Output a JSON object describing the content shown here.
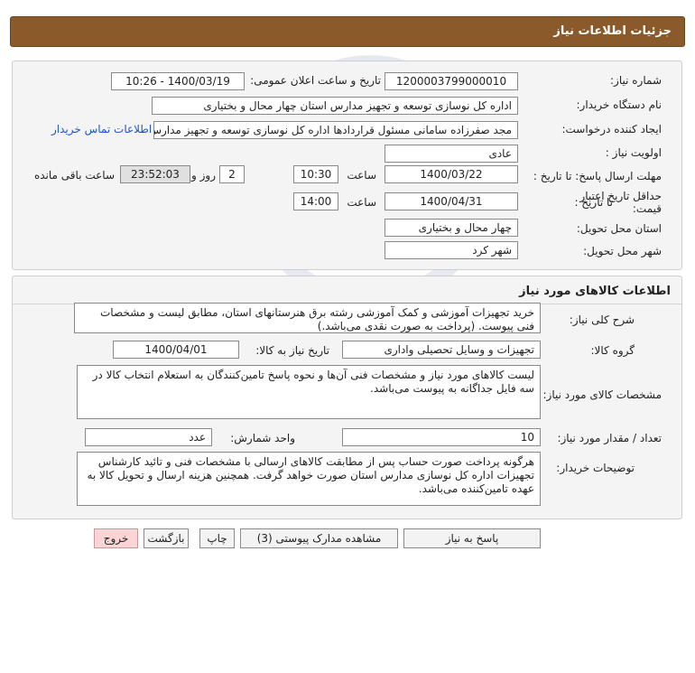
{
  "header": {
    "title": "جزئیات اطلاعات نیاز"
  },
  "fields": {
    "need_number_label": "شماره نیاز:",
    "need_number": "1200003799000010",
    "announce_label": "تاریخ و ساعت اعلان عمومی:",
    "announce_value": "1400/03/19 - 10:26",
    "buyer_label": "نام دستگاه خریدار:",
    "buyer_value": "اداره کل نوسازی  توسعه و تجهیز مدارس استان چهار محال و بختیاری",
    "creator_label": "ایجاد کننده درخواست:",
    "creator_value": "مجد صفرزاده سامانی مسئول قراردادها اداره کل نوسازی  توسعه و تجهیز مدارس",
    "contact_link": "اطلاعات تماس خریدار",
    "priority_label": "اولویت نیاز :",
    "priority_value": "عادی",
    "deadline_label": "مهلت ارسال پاسخ: تا تاریخ :",
    "deadline_date": "1400/03/22",
    "time_label": "ساعت",
    "deadline_time": "10:30",
    "days_value": "2",
    "days_label": "روز و",
    "remaining_time": "23:52:03",
    "remaining_label": "ساعت باقی مانده",
    "validity_label_1": "حداقل تاریخ اعتبار",
    "validity_label_2": "قیمت:",
    "validity_to_label": "تا تاریخ :",
    "validity_date": "1400/04/31",
    "validity_time_label": "ساعت",
    "validity_time": "14:00",
    "province_label": "استان محل تحویل:",
    "province_value": "چهار محال و بختیاری",
    "city_label": "شهر محل تحویل:",
    "city_value": "شهر کرد"
  },
  "goods": {
    "section_title": "اطلاعات کالاهای مورد نیاز",
    "summary_label": "شرح کلی نیاز:",
    "summary_value": "خرید تجهیزات آموزشی و کمک آموزشی رشته برق هنرستانهای استان، مطابق لیست و مشخصات فنی پیوست. (پرداخت به صورت نقدی می‌باشد.)",
    "group_label": "گروه کالا:",
    "group_value": "تجهیزات و وسایل تحصیلی واداری",
    "need_date_label": "تاریخ نیاز به کالا:",
    "need_date": "1400/04/01",
    "specs_label": "مشخصات کالای مورد نیاز:",
    "specs_value": "لیست کالاهای مورد نیاز و مشخصات فنی آن‌ها و نحوه پاسخ تامین‌کنندگان به استعلام انتخاب کالا در سه فایل جداگانه به پیوست می‌باشد.",
    "qty_label": "تعداد / مقدار مورد نیاز:",
    "qty_value": "10",
    "unit_label": "واحد شمارش:",
    "unit_value": "عدد",
    "notes_label": "توضیحات خریدار:",
    "notes_value": "هرگونه پرداخت صورت حساب پس از مطابقت کالاهای ارسالی با مشخصات فنی و تائید کارشناس تجهیزات اداره کل نوسازی مدارس استان صورت خواهد گرفت. همچنین هزینه ارسال و تحویل کالا به عهده تامین‌کننده می‌باشد."
  },
  "buttons": {
    "reply": "پاسخ به نیاز",
    "attachments": "مشاهده مدارک پیوستی (3)",
    "print": "چاپ",
    "back": "بازگشت",
    "exit": "خروج"
  },
  "colors": {
    "header_bg": "#8b5a2b",
    "link": "#1a56c4",
    "exit_bg": "#fbd5d5"
  }
}
